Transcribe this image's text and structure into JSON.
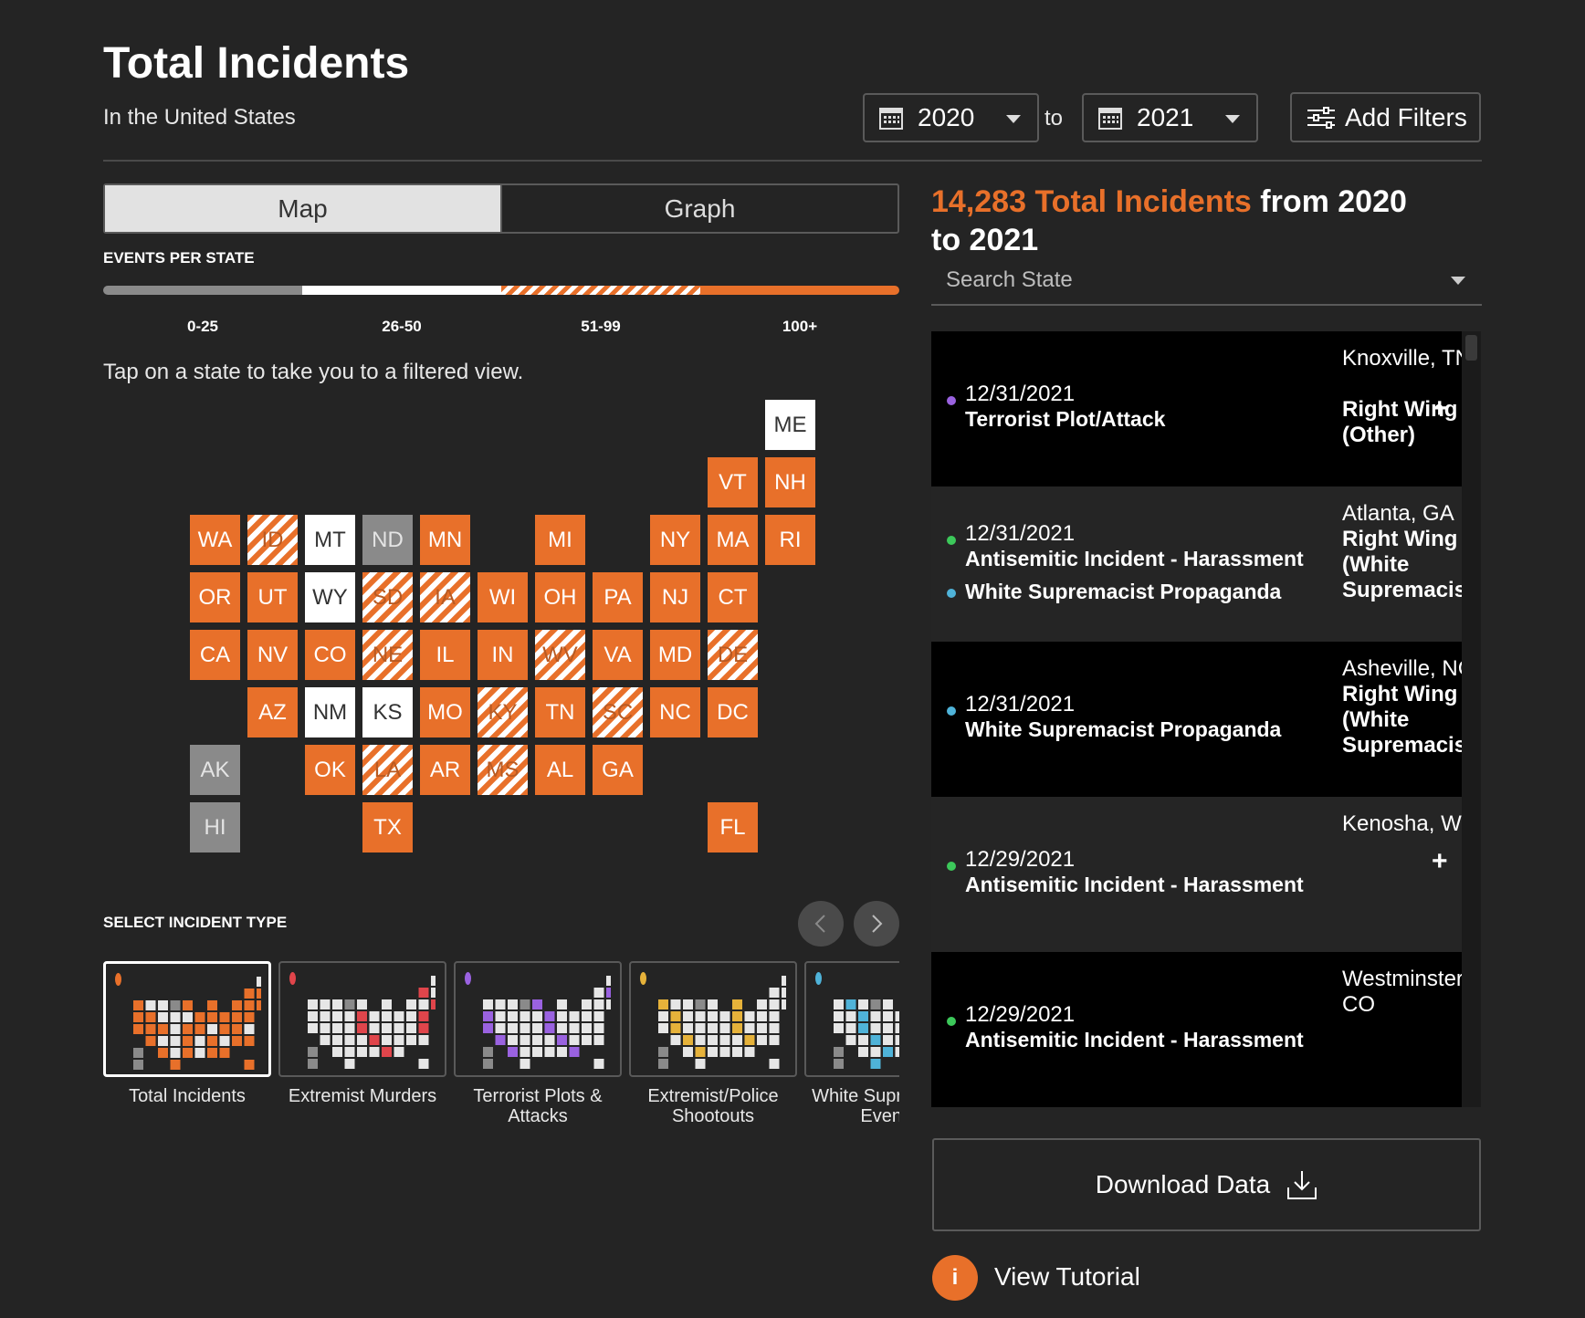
{
  "header": {
    "title": "Total Incidents",
    "subtitle": "In the United States",
    "from_year": "2020",
    "to_label": "to",
    "to_year": "2021",
    "filters_label": "Add Filters"
  },
  "view_toggle": {
    "map_label": "Map",
    "graph_label": "Graph",
    "active": "Map"
  },
  "legend": {
    "title": "EVENTS PER STATE",
    "buckets": [
      {
        "label": "0-25",
        "color": "#8a8a8a"
      },
      {
        "label": "26-50",
        "color": "#ffffff"
      },
      {
        "label": "51-99",
        "color": "striped"
      },
      {
        "label": "100+",
        "color": "#e8702a"
      }
    ]
  },
  "hint": "Tap on a state to take you to a filtered view.",
  "states": [
    {
      "code": "ME",
      "row": 0,
      "col": 10,
      "bucket": "26-50"
    },
    {
      "code": "VT",
      "row": 1,
      "col": 9,
      "bucket": "100+"
    },
    {
      "code": "NH",
      "row": 1,
      "col": 10,
      "bucket": "100+"
    },
    {
      "code": "WA",
      "row": 2,
      "col": 0,
      "bucket": "100+"
    },
    {
      "code": "ID",
      "row": 2,
      "col": 1,
      "bucket": "51-99"
    },
    {
      "code": "MT",
      "row": 2,
      "col": 2,
      "bucket": "26-50"
    },
    {
      "code": "ND",
      "row": 2,
      "col": 3,
      "bucket": "0-25"
    },
    {
      "code": "MN",
      "row": 2,
      "col": 4,
      "bucket": "100+"
    },
    {
      "code": "MI",
      "row": 2,
      "col": 6,
      "bucket": "100+"
    },
    {
      "code": "NY",
      "row": 2,
      "col": 8,
      "bucket": "100+"
    },
    {
      "code": "MA",
      "row": 2,
      "col": 9,
      "bucket": "100+"
    },
    {
      "code": "RI",
      "row": 2,
      "col": 10,
      "bucket": "100+"
    },
    {
      "code": "OR",
      "row": 3,
      "col": 0,
      "bucket": "100+"
    },
    {
      "code": "UT",
      "row": 3,
      "col": 1,
      "bucket": "100+"
    },
    {
      "code": "WY",
      "row": 3,
      "col": 2,
      "bucket": "26-50"
    },
    {
      "code": "SD",
      "row": 3,
      "col": 3,
      "bucket": "51-99"
    },
    {
      "code": "IA",
      "row": 3,
      "col": 4,
      "bucket": "51-99"
    },
    {
      "code": "WI",
      "row": 3,
      "col": 5,
      "bucket": "100+"
    },
    {
      "code": "OH",
      "row": 3,
      "col": 6,
      "bucket": "100+"
    },
    {
      "code": "PA",
      "row": 3,
      "col": 7,
      "bucket": "100+"
    },
    {
      "code": "NJ",
      "row": 3,
      "col": 8,
      "bucket": "100+"
    },
    {
      "code": "CT",
      "row": 3,
      "col": 9,
      "bucket": "100+"
    },
    {
      "code": "CA",
      "row": 4,
      "col": 0,
      "bucket": "100+"
    },
    {
      "code": "NV",
      "row": 4,
      "col": 1,
      "bucket": "100+"
    },
    {
      "code": "CO",
      "row": 4,
      "col": 2,
      "bucket": "100+"
    },
    {
      "code": "NE",
      "row": 4,
      "col": 3,
      "bucket": "51-99"
    },
    {
      "code": "IL",
      "row": 4,
      "col": 4,
      "bucket": "100+"
    },
    {
      "code": "IN",
      "row": 4,
      "col": 5,
      "bucket": "100+"
    },
    {
      "code": "WV",
      "row": 4,
      "col": 6,
      "bucket": "51-99"
    },
    {
      "code": "VA",
      "row": 4,
      "col": 7,
      "bucket": "100+"
    },
    {
      "code": "MD",
      "row": 4,
      "col": 8,
      "bucket": "100+"
    },
    {
      "code": "DE",
      "row": 4,
      "col": 9,
      "bucket": "51-99"
    },
    {
      "code": "AZ",
      "row": 5,
      "col": 1,
      "bucket": "100+"
    },
    {
      "code": "NM",
      "row": 5,
      "col": 2,
      "bucket": "26-50"
    },
    {
      "code": "KS",
      "row": 5,
      "col": 3,
      "bucket": "26-50"
    },
    {
      "code": "MO",
      "row": 5,
      "col": 4,
      "bucket": "100+"
    },
    {
      "code": "KY",
      "row": 5,
      "col": 5,
      "bucket": "51-99"
    },
    {
      "code": "TN",
      "row": 5,
      "col": 6,
      "bucket": "100+"
    },
    {
      "code": "SC",
      "row": 5,
      "col": 7,
      "bucket": "51-99"
    },
    {
      "code": "NC",
      "row": 5,
      "col": 8,
      "bucket": "100+"
    },
    {
      "code": "DC",
      "row": 5,
      "col": 9,
      "bucket": "100+"
    },
    {
      "code": "AK",
      "row": 6,
      "col": 0,
      "bucket": "0-25"
    },
    {
      "code": "OK",
      "row": 6,
      "col": 2,
      "bucket": "100+"
    },
    {
      "code": "LA",
      "row": 6,
      "col": 3,
      "bucket": "51-99"
    },
    {
      "code": "AR",
      "row": 6,
      "col": 4,
      "bucket": "100+"
    },
    {
      "code": "MS",
      "row": 6,
      "col": 5,
      "bucket": "51-99"
    },
    {
      "code": "AL",
      "row": 6,
      "col": 6,
      "bucket": "100+"
    },
    {
      "code": "GA",
      "row": 6,
      "col": 7,
      "bucket": "100+"
    },
    {
      "code": "HI",
      "row": 7,
      "col": 0,
      "bucket": "0-25"
    },
    {
      "code": "TX",
      "row": 7,
      "col": 3,
      "bucket": "100+"
    },
    {
      "code": "FL",
      "row": 7,
      "col": 9,
      "bucket": "100+"
    }
  ],
  "incident_types": {
    "title": "SELECT INCIDENT TYPE",
    "items": [
      {
        "label": "Total Incidents",
        "color": "#e8702a",
        "active": true
      },
      {
        "label": "Extremist Murders",
        "color": "#e0454b",
        "active": false
      },
      {
        "label": "Terrorist Plots & Attacks",
        "color": "#9a62e0",
        "active": false
      },
      {
        "label": "Extremist/Police Shootouts",
        "color": "#e6b23a",
        "active": false
      },
      {
        "label": "White Supremacist Events",
        "color": "#4fb3d9",
        "active": false
      }
    ]
  },
  "summary": {
    "count_text": "14,283 Total Incidents",
    "range_text": " from 2020 to 2021"
  },
  "search": {
    "placeholder": "Search State"
  },
  "incidents": [
    {
      "date": "12/31/2021",
      "types": [
        {
          "label": "Terrorist Plot/Attack",
          "color": "#9a62e0"
        }
      ],
      "location": "Knoxville, TN",
      "ideology": "Right Wing (Other)"
    },
    {
      "date": "12/31/2021",
      "types": [
        {
          "label": "Antisemitic Incident - Harassment",
          "color": "#3cc85a"
        },
        {
          "label": "White Supremacist Propaganda",
          "color": "#4fb3d9"
        }
      ],
      "location": "Atlanta, GA",
      "ideology": "Right Wing (White Supremacist)"
    },
    {
      "date": "12/31/2021",
      "types": [
        {
          "label": "White Supremacist Propaganda",
          "color": "#4fb3d9"
        }
      ],
      "location": "Asheville, NC",
      "ideology": "Right Wing (White Supremacist)"
    },
    {
      "date": "12/29/2021",
      "types": [
        {
          "label": "Antisemitic Incident - Harassment",
          "color": "#3cc85a"
        }
      ],
      "location": "Kenosha, WI",
      "ideology": ""
    },
    {
      "date": "12/29/2021",
      "types": [
        {
          "label": "Antisemitic Incident - Harassment",
          "color": "#3cc85a"
        }
      ],
      "location": "Westminster, CO",
      "ideology": ""
    }
  ],
  "download_label": "Download Data",
  "tutorial": {
    "icon": "i",
    "label": "View Tutorial"
  }
}
